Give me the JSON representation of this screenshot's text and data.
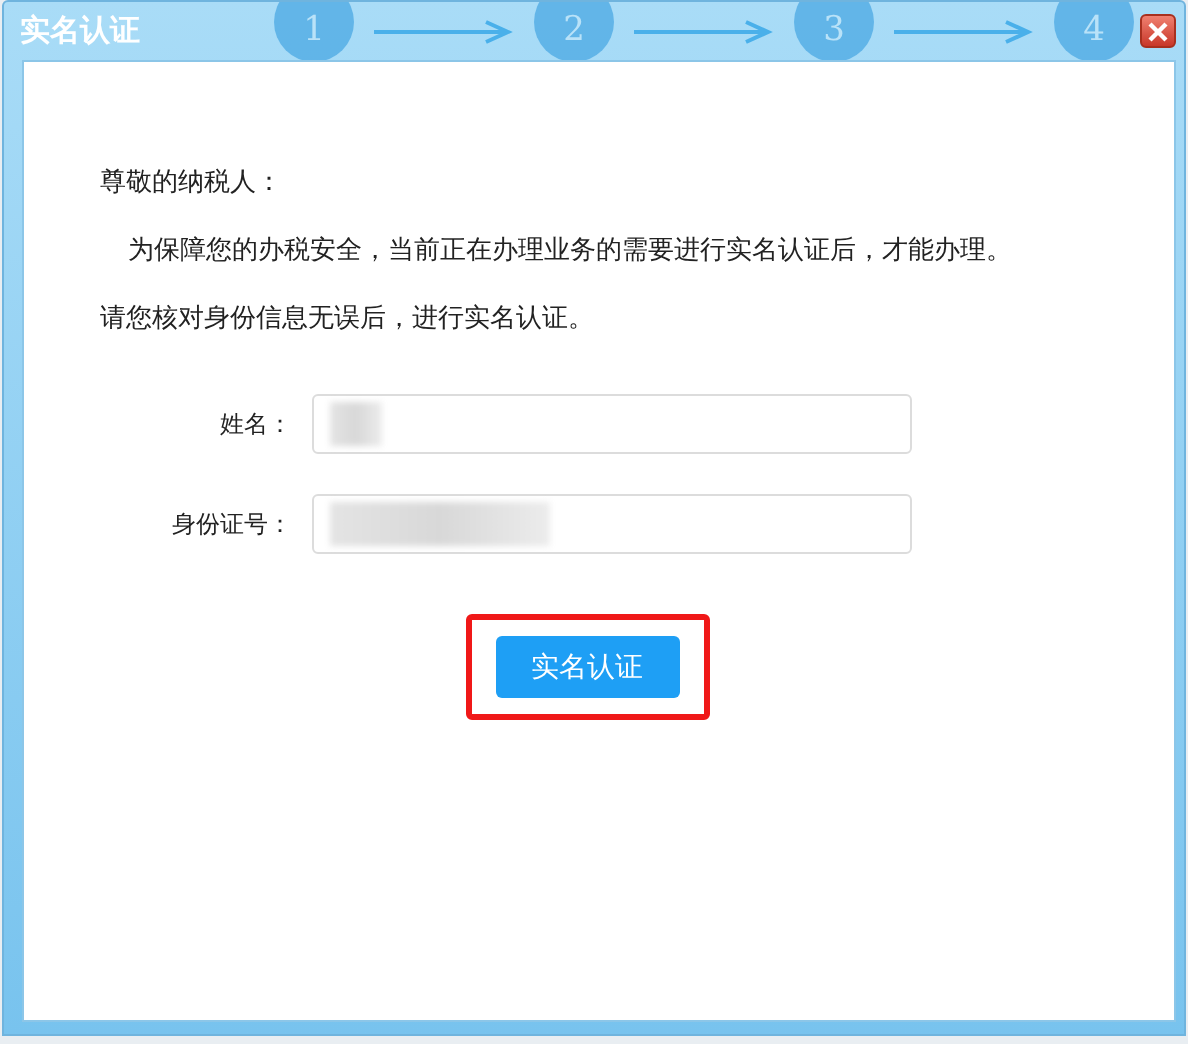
{
  "window": {
    "title": "实名认证"
  },
  "steps": [
    "1",
    "2",
    "3",
    "4"
  ],
  "greeting": "尊敬的纳税人：",
  "paragraphs": [
    "为保障您的办税安全，当前正在办理业务的需要进行实名认证后，才能办理。",
    "请您核对身份信息无误后，进行实名认证。"
  ],
  "fields": [
    {
      "label": "姓名：",
      "redacted": true
    },
    {
      "label": "身份证号：",
      "redacted": true
    }
  ],
  "submit": {
    "label": "实名认证",
    "highlighted": true
  }
}
